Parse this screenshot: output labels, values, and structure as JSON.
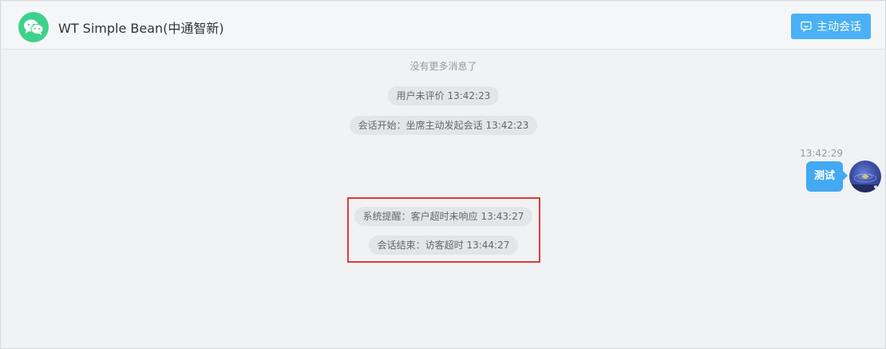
{
  "header": {
    "title": "WT Simple Bean(中通智新)",
    "avatar_icon": "wechat-icon",
    "active_chat_label": "主动会话",
    "active_chat_icon": "chat-bubble-icon",
    "accent_color": "#4ab1f6"
  },
  "chat": {
    "no_more_text": "没有更多消息了",
    "system_messages": [
      {
        "text": "用户未评价 13:42:23"
      },
      {
        "text": "会话开始：坐席主动发起会话 13:42:23"
      },
      {
        "text": "系统提醒：客户超时未响应 13:43:27"
      },
      {
        "text": "会话结束：访客超时 13:44:27"
      }
    ],
    "outgoing_message": {
      "time": "13:42:29",
      "text": "测试",
      "bubble_color": "#43a9f3"
    },
    "highlight_color": "#e03b3b"
  }
}
